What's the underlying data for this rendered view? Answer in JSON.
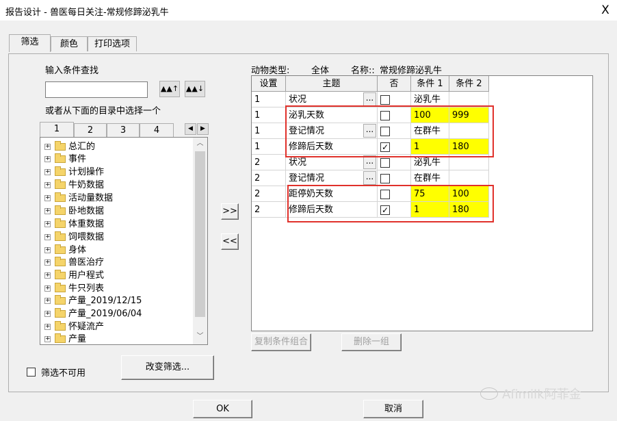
{
  "window": {
    "title": "报告设计 - 兽医每日关注-常规修蹄泌乳牛",
    "close": "X"
  },
  "tabs": [
    "筛选",
    "颜色",
    "打印选项"
  ],
  "search": {
    "label": "输入条件查找",
    "value": "",
    "up_icon": "binoculars-up",
    "down_icon": "binoculars-down"
  },
  "catalog": {
    "label": "或者从下面的目录中选择一个",
    "subtabs": [
      "1",
      "2",
      "3",
      "4"
    ],
    "scroll_left": "◀",
    "scroll_right": "▶"
  },
  "tree": {
    "items": [
      "总汇的",
      "事件",
      "计划操作",
      "牛奶数据",
      "活动量数据",
      "卧地数据",
      "体重数据",
      "饲喂数据",
      "身体",
      "兽医治疗",
      "用户程式",
      "牛只列表",
      "产量_2019/12/15",
      "产量_2019/06/04",
      "怀疑流产",
      "产量"
    ]
  },
  "transfer": {
    "add": ">>",
    "remove": "<<"
  },
  "info": {
    "animal_type_label": "动物类型:",
    "animal_type_value": "全体",
    "name_label": "名称::",
    "name_value": "常规修蹄泌乳牛"
  },
  "grid": {
    "headers": [
      "设置",
      "主题",
      "否",
      "条件 1",
      "条件 2"
    ],
    "rows": [
      {
        "set": "1",
        "subject": "状况",
        "ellipsis": true,
        "no": false,
        "c1": "泌乳牛",
        "c2": "",
        "hl": false
      },
      {
        "set": "1",
        "subject": "泌乳天数",
        "ellipsis": false,
        "no": false,
        "c1": "100",
        "c2": "999",
        "hl": true
      },
      {
        "set": "1",
        "subject": "登记情况",
        "ellipsis": true,
        "no": false,
        "c1": "在群牛",
        "c2": "",
        "hl": false
      },
      {
        "set": "1",
        "subject": "修蹄后天数",
        "ellipsis": false,
        "no": true,
        "c1": "1",
        "c2": "180",
        "hl": true
      },
      {
        "set": "2",
        "subject": "状况",
        "ellipsis": true,
        "no": false,
        "c1": "泌乳牛",
        "c2": "",
        "hl": false
      },
      {
        "set": "2",
        "subject": "登记情况",
        "ellipsis": true,
        "no": false,
        "c1": "在群牛",
        "c2": "",
        "hl": false
      },
      {
        "set": "2",
        "subject": "距停奶天数",
        "ellipsis": false,
        "no": false,
        "c1": "75",
        "c2": "100",
        "hl": true
      },
      {
        "set": "2",
        "subject": "修蹄后天数",
        "ellipsis": false,
        "no": true,
        "c1": "1",
        "c2": "180",
        "hl": true
      }
    ]
  },
  "actions": {
    "copy_group": "复制条件组合",
    "delete_group": "删除一组",
    "filter_disabled": "筛选不可用",
    "change_filter": "改变筛选...",
    "ok": "OK",
    "cancel": "取消"
  },
  "watermark": "Afimilk阿菲金",
  "colors": {
    "highlight": "#ffff00",
    "annotation_red": "#e0302a"
  }
}
